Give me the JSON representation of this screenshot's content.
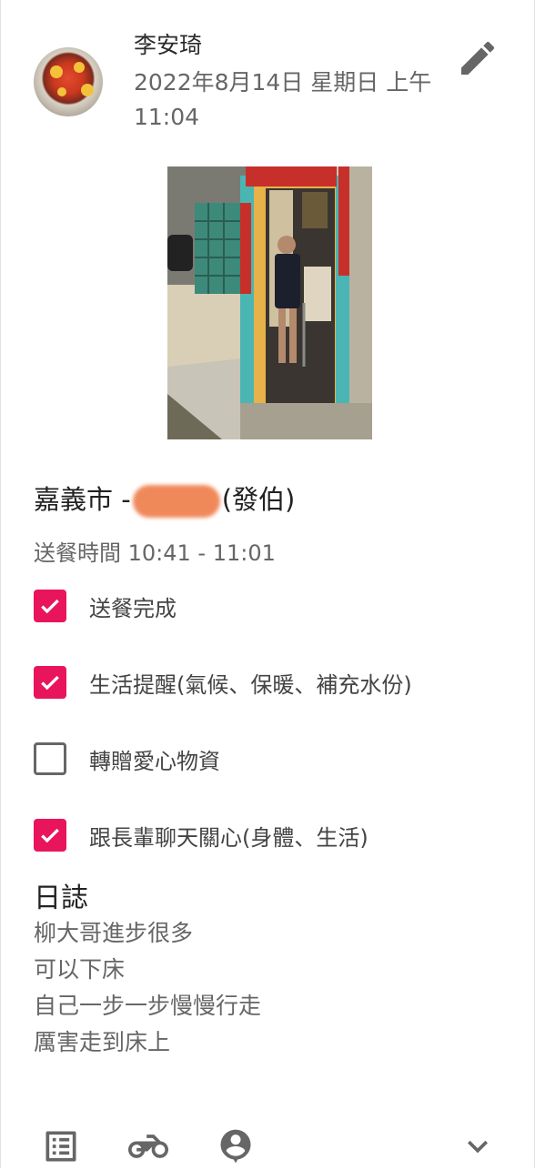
{
  "post": {
    "author": "李安琦",
    "date": "2022年8月14日 星期日 上午11:04"
  },
  "visit": {
    "title_prefix": "嘉義市 -",
    "title_suffix": "(發伯)",
    "time_label": "送餐時間",
    "time_range": "10:41 - 11:01"
  },
  "checklist": [
    {
      "label": "送餐完成",
      "checked": true
    },
    {
      "label": "生活提醒(氣候、保暖、補充水份)",
      "checked": true
    },
    {
      "label": "轉贈愛心物資",
      "checked": false
    },
    {
      "label": "跟長輩聊天關心(身體、生活)",
      "checked": true
    }
  ],
  "log": {
    "heading": "日誌",
    "lines": [
      "柳大哥進步很多",
      "可以下床",
      "自己一步一步慢慢行走",
      "厲害走到床上"
    ]
  },
  "icons": {
    "edit": "pencil-icon",
    "list": "list-icon",
    "delivery": "motorcycle-icon",
    "person": "person-pin-icon",
    "expand": "chevron-down-icon"
  },
  "colors": {
    "checkbox_checked": "#e8155c",
    "icon_gray": "#666666"
  }
}
